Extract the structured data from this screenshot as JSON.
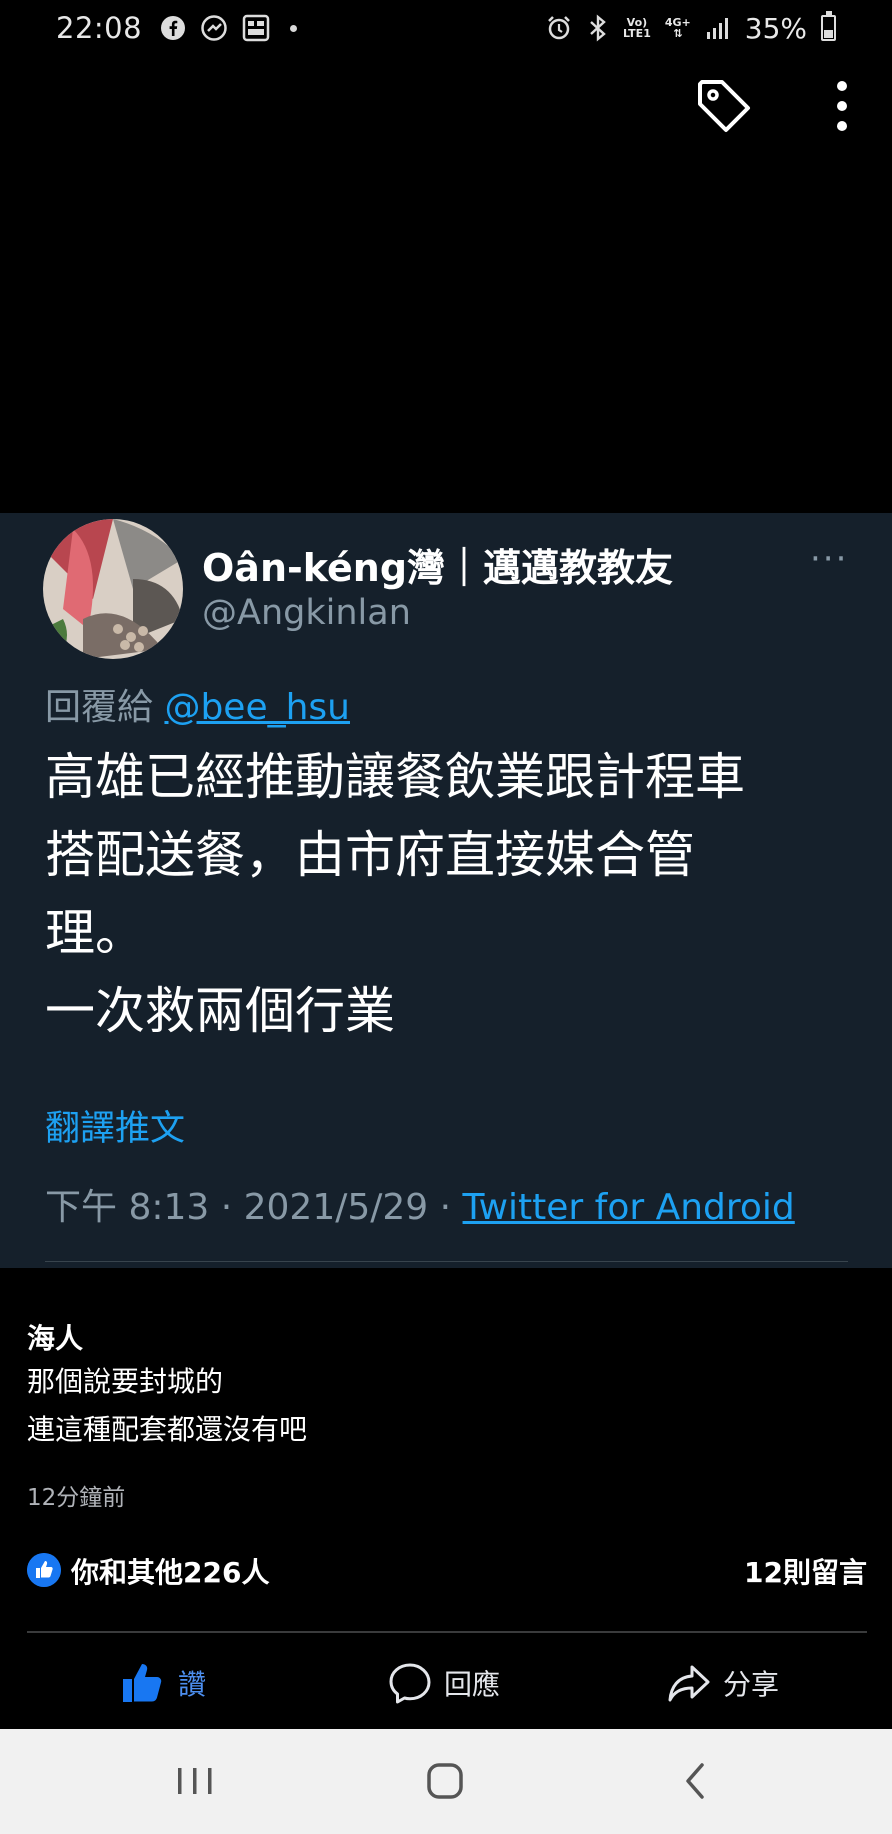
{
  "status_bar": {
    "time": "22:08",
    "network_top": "Vo)",
    "network_bottom": "LTE1",
    "data_type": "4G+",
    "battery": "35%",
    "battery_level": 0.35
  },
  "tweet": {
    "display_name": "Oân-kéng灣｜邁邁教教友",
    "handle": "@Angkinlan",
    "replying_prefix": "回覆給 ",
    "replying_to": "@bee_hsu",
    "body": "高雄已經推動讓餐飲業跟計程車\n搭配送餐，由市府直接媒合管\n理。\n一次救兩個行業",
    "translate_label": "翻譯推文",
    "time_date": "下午 8:13 · 2021/5/29 · ",
    "source": "Twitter for Android",
    "more_label": "···"
  },
  "caption": {
    "author": "海人",
    "text": "那個說要封城的\n連這種配套都還沒有吧",
    "time": "12分鐘前"
  },
  "reactions": {
    "count_label": "你和其他226人",
    "comments_label": "12則留言"
  },
  "actions": {
    "like": "讚",
    "comment": "回應",
    "share": "分享"
  },
  "colors": {
    "tweet_bg": "#15202b",
    "twitter_blue": "#1da1f2",
    "facebook_blue": "#1877f2"
  }
}
